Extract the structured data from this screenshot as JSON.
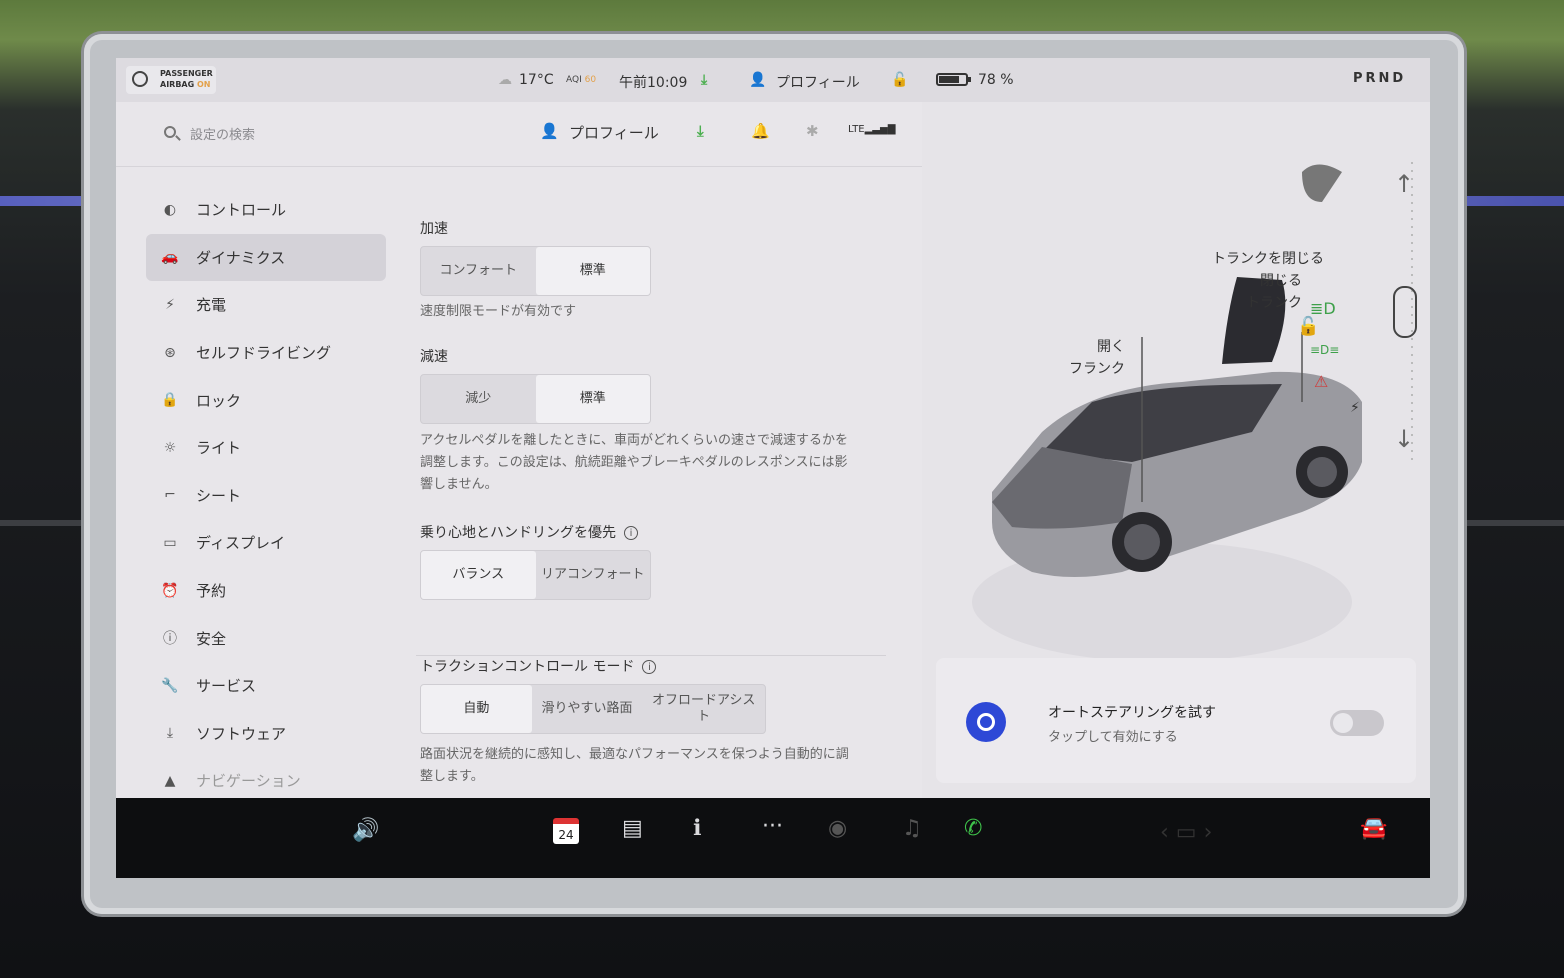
{
  "status_bar": {
    "airbag_line1": "PASSENGER",
    "airbag_line2": "AIRBAG",
    "airbag_state": "ON",
    "temperature": "17°C",
    "aqi_label": "AQI",
    "aqi_value": "60",
    "time": "午前10:09",
    "profile": "プロフィール",
    "battery_percent": "78 %",
    "battery_level": 0.78,
    "gear": "PRND"
  },
  "topbar": {
    "search_placeholder": "設定の検索",
    "profile": "プロフィール"
  },
  "sidebar": {
    "items": [
      {
        "label": "コントロール",
        "icon": "toggle-icon"
      },
      {
        "label": "ダイナミクス",
        "icon": "car-icon"
      },
      {
        "label": "充電",
        "icon": "bolt-icon"
      },
      {
        "label": "セルフドライビング",
        "icon": "steering-wheel-icon"
      },
      {
        "label": "ロック",
        "icon": "lock-icon"
      },
      {
        "label": "ライト",
        "icon": "light-icon"
      },
      {
        "label": "シート",
        "icon": "seat-icon"
      },
      {
        "label": "ディスプレイ",
        "icon": "display-icon"
      },
      {
        "label": "予約",
        "icon": "alarm-icon"
      },
      {
        "label": "安全",
        "icon": "info-icon"
      },
      {
        "label": "サービス",
        "icon": "wrench-icon"
      },
      {
        "label": "ソフトウェア",
        "icon": "download-icon"
      },
      {
        "label": "ナビゲーション",
        "icon": "navigation-icon"
      }
    ],
    "active_index": 1
  },
  "dynamics": {
    "acceleration": {
      "label": "加速",
      "options": [
        "コンフォート",
        "標準"
      ],
      "selected": 1,
      "note": "速度制限モードが有効です"
    },
    "deceleration": {
      "label": "減速",
      "options": [
        "減少",
        "標準"
      ],
      "selected": 1,
      "desc_line1": "アクセルペダルを離したときに、車両がどれくらいの速さで減速するかを",
      "desc_line2": "調整します。この設定は、航続距離やブレーキペダルのレスポンスには影",
      "desc_line3": "響しません。"
    },
    "ride": {
      "label": "乗り心地とハンドリングを優先",
      "options": [
        "バランス",
        "リアコンフォート"
      ],
      "selected": 0
    },
    "traction": {
      "label": "トラクションコントロール モード",
      "options": [
        "自動",
        "滑りやすい路面",
        "オフロードアシスト"
      ],
      "selected": 0,
      "desc_line1": "路面状況を継続的に感知し、最適なパフォーマンスを保つよう自動的に調",
      "desc_line2": "整します。"
    }
  },
  "car_viewer": {
    "trunk_close": "トランクを閉じる",
    "trunk_line1": "閉じる",
    "trunk_line2": "トランク",
    "frunk_line1": "開く",
    "frunk_line2": "フランク"
  },
  "autosteer": {
    "title": "オートステアリングを試す",
    "subtitle": "タップして有効にする"
  },
  "taskbar": {
    "calendar_day": "24"
  }
}
